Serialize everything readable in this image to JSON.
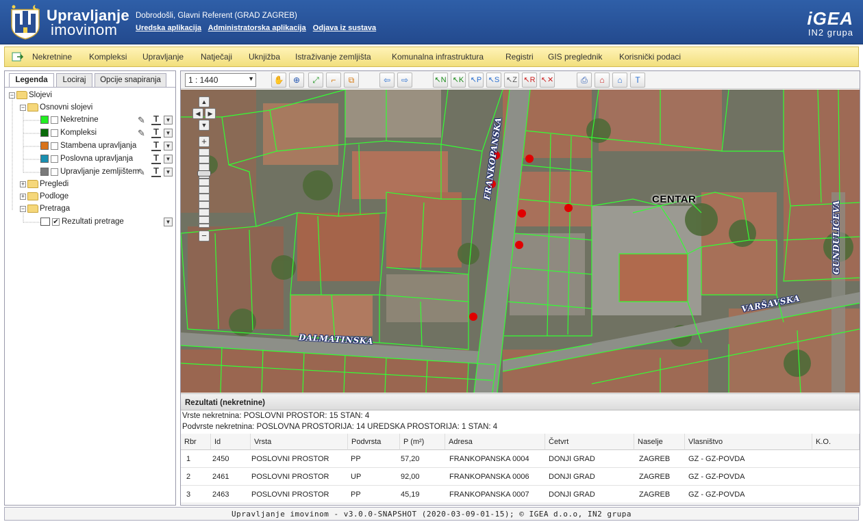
{
  "header": {
    "title_line1": "Upravljanje",
    "title_line2": "imovinom",
    "welcome": "Dobrodošli, Glavni Referent (GRAD ZAGREB)",
    "links": [
      "Uredska aplikacija",
      "Administratorska aplikacija",
      "Odjava iz sustava"
    ],
    "brand_line1": "iGEA",
    "brand_line2": "IN2 grupa"
  },
  "menu": {
    "items": [
      "Nekretnine",
      "Kompleksi",
      "Upravljanje",
      "Natječaji",
      "Uknjižba",
      "Istraživanje zemljišta",
      "Komunalna infrastruktura",
      "Registri",
      "GIS preglednik",
      "Korisnički podaci"
    ]
  },
  "left_panel": {
    "tabs": [
      "Legenda",
      "Lociraj",
      "Opcije snapiranja"
    ],
    "active_tab": "Legenda",
    "tree": {
      "root": "Slojevi",
      "basic_group": "Osnovni slojevi",
      "layers": [
        {
          "label": "Nekretnine",
          "color": "#22ee22"
        },
        {
          "label": "Kompleksi",
          "color": "#0a6b0a"
        },
        {
          "label": "Stambena upravljanja",
          "color": "#d9731a"
        },
        {
          "label": "Poslovna upravljanja",
          "color": "#1a8fb0"
        },
        {
          "label": "Upravljanje zemljištem",
          "color": "#7a7a7a"
        }
      ],
      "groups": [
        "Pregledi",
        "Podloge",
        "Pretraga"
      ],
      "search_result": "Rezultati pretrage"
    }
  },
  "toolbar": {
    "scale": "1 : 1440"
  },
  "map": {
    "streets": {
      "frankopanska": "FRANKOPANSKA",
      "dalmatinska": "DALMATINSKA",
      "varsavska": "VARŠAVSKA",
      "gunduliceva": "GUNDULIĆEVA"
    },
    "district": "CENTAR",
    "marker_color": "#e00000",
    "parcel_color": "#33ff33"
  },
  "results": {
    "title": "Rezultati (nekretnine)",
    "summary_types": "Vrste nekretnina: POSLOVNI PROSTOR: 15 STAN: 4",
    "summary_subtypes": "Podvrste nekretnina: POSLOVNA PROSTORIJA: 14 UREDSKA PROSTORIJA: 1 STAN: 4",
    "columns": [
      "Rbr",
      "Id",
      "Vrsta",
      "Podvrsta",
      "P (m²)",
      "Adresa",
      "Četvrt",
      "Naselje",
      "Vlasništvo",
      "K.O."
    ],
    "rows": [
      [
        "1",
        "2450",
        "POSLOVNI PROSTOR",
        "PP",
        "57,20",
        "FRANKOPANSKA 0004",
        "DONJI GRAD",
        "ZAGREB",
        "GZ - GZ-POVDA",
        ""
      ],
      [
        "2",
        "2461",
        "POSLOVNI PROSTOR",
        "UP",
        "92,00",
        "FRANKOPANSKA 0006",
        "DONJI GRAD",
        "ZAGREB",
        "GZ - GZ-POVDA",
        ""
      ],
      [
        "3",
        "2463",
        "POSLOVNI PROSTOR",
        "PP",
        "45,19",
        "FRANKOPANSKA 0007",
        "DONJI GRAD",
        "ZAGREB",
        "GZ - GZ-POVDA",
        ""
      ]
    ]
  },
  "footer": {
    "text": "Upravljanje imovinom - v3.0.0-SNAPSHOT (2020-03-09-01-15); © IGEA d.o.o, IN2 grupa"
  }
}
